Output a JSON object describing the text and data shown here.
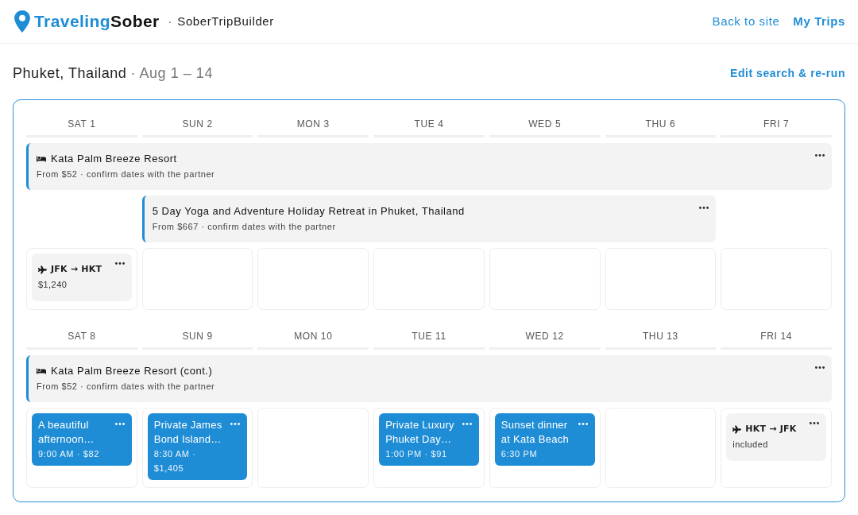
{
  "header": {
    "logo": {
      "first_part": "Traveling",
      "second_part": "Sober"
    },
    "separator": "·",
    "app_name": "SoberTripBuilder",
    "nav_links": [
      {
        "label": "Back to site",
        "emphasized": false
      },
      {
        "label": "My Trips",
        "emphasized": true
      }
    ]
  },
  "trip": {
    "destination": "Phuket, Thailand",
    "dates": "· Aug 1 – 14",
    "edit_link": "Edit search & re-run"
  },
  "calendar": {
    "weeks": [
      {
        "days": [
          {
            "label": "SAT 1",
            "items": [
              {
                "kind": "flight",
                "route": "JFK → HKT",
                "detail": "$1,240"
              }
            ]
          },
          {
            "label": "SUN 2"
          },
          {
            "label": "MON 3"
          },
          {
            "label": "TUE 4"
          },
          {
            "label": "WED 5"
          },
          {
            "label": "THU 6"
          },
          {
            "label": "FRI 7"
          }
        ],
        "bar_rows": [
          {
            "slots": [
              {
                "kind": "lodging",
                "title": "Kata Palm Breeze Resort",
                "subtitle": "From $52 · confirm dates with the partner"
              },
              {
                "kind": "continued"
              },
              {
                "kind": "continued"
              },
              {
                "kind": "continued"
              },
              {
                "kind": "continued"
              },
              {
                "kind": "continued"
              },
              {
                "kind": "continued"
              }
            ]
          },
          {
            "slots": [
              {
                "kind": "empty"
              },
              {
                "kind": "tour",
                "title": "5 Day Yoga and Adventure Holiday Retreat in Phuket, Thailand",
                "subtitle": "From $667 · confirm dates with the partner"
              },
              {
                "kind": "continued"
              },
              {
                "kind": "continued"
              },
              {
                "kind": "continued"
              },
              {
                "kind": "continued"
              },
              {
                "kind": "empty"
              }
            ]
          }
        ]
      },
      {
        "days": [
          {
            "label": "SAT 8",
            "items": [
              {
                "kind": "activity",
                "title": "A beautiful afternoon…",
                "detail": "9:00 AM · $82"
              }
            ]
          },
          {
            "label": "SUN 9",
            "items": [
              {
                "kind": "activity",
                "title": "Private James Bond Island…",
                "detail": "8:30 AM · $1,405"
              }
            ]
          },
          {
            "label": "MON 10"
          },
          {
            "label": "TUE 11",
            "items": [
              {
                "kind": "activity",
                "title": "Private Luxury Phuket Day…",
                "detail": "1:00 PM · $91"
              }
            ]
          },
          {
            "label": "WED 12",
            "items": [
              {
                "kind": "activity",
                "title": "Sunset dinner at Kata Beach",
                "detail": "6:30 PM"
              }
            ]
          },
          {
            "label": "THU 13"
          },
          {
            "label": "FRI 14",
            "items": [
              {
                "kind": "flight",
                "route": "HKT → JFK",
                "detail": "included"
              }
            ]
          }
        ],
        "bar_rows": [
          {
            "slots": [
              {
                "kind": "lodging",
                "title": "Kata Palm Breeze Resort (cont.)",
                "subtitle": "From $52 · confirm dates with the partner"
              },
              {
                "kind": "continued"
              },
              {
                "kind": "continued"
              },
              {
                "kind": "continued"
              },
              {
                "kind": "continued"
              },
              {
                "kind": "continued"
              },
              {
                "kind": "continued"
              }
            ]
          }
        ]
      }
    ]
  }
}
